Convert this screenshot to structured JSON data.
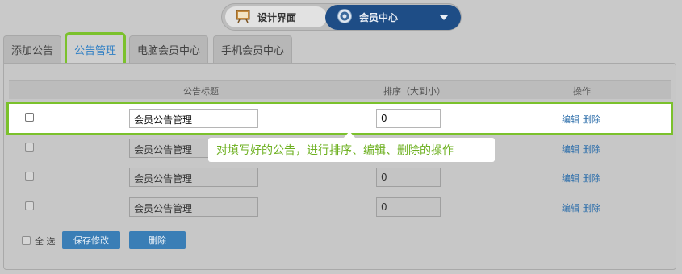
{
  "mode_switcher": {
    "left_label": "设计界面",
    "left_icon": "easel-icon",
    "right_label": "会员中心",
    "right_icon": "gear-icon"
  },
  "tabs": [
    {
      "label": "添加公告",
      "active": false
    },
    {
      "label": "公告管理",
      "active": true
    },
    {
      "label": "电脑会员中心",
      "active": false
    },
    {
      "label": "手机会员中心",
      "active": false
    }
  ],
  "table": {
    "headers": {
      "title": "公告标题",
      "order": "排序（大到小）",
      "actions": "操作"
    },
    "rows": [
      {
        "title": "会员公告管理",
        "order": "0",
        "edit": "编辑",
        "delete": "删除"
      },
      {
        "title": "会员公告管理",
        "order": "0",
        "edit": "编辑",
        "delete": "删除"
      },
      {
        "title": "会员公告管理",
        "order": "0",
        "edit": "编辑",
        "delete": "删除"
      },
      {
        "title": "会员公告管理",
        "order": "0",
        "edit": "编辑",
        "delete": "删除"
      }
    ]
  },
  "callout": {
    "text": "对填写好的公告，进行排序、编辑、删除的操作"
  },
  "footer": {
    "select_all": "全 选",
    "save_label": "保存修改",
    "delete_label": "删除"
  },
  "colors": {
    "accent": "#7bc12c",
    "button": "#3a7eb6",
    "switch_active": "#1e4d86",
    "link": "#2e6fab"
  }
}
